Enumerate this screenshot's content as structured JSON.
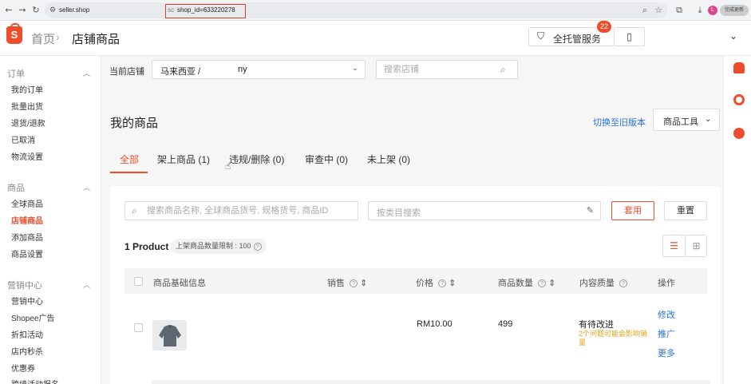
{
  "browser": {
    "url_host": "seller.shop",
    "url_mid": "sc",
    "url_query": "shop_id=633220278",
    "finish_label": "完成更新",
    "avatar_initial": "L",
    "icons": [
      "back-icon",
      "forward-icon",
      "reload-icon",
      "site-info-icon",
      "zoom-icon",
      "star-icon",
      "extensions-icon",
      "download-icon",
      "chrome-menu-icon"
    ]
  },
  "header": {
    "breadcrumb_home": "首页",
    "breadcrumb_current": "店铺商品",
    "service_label": "全托管服务",
    "service_badge": "22"
  },
  "sidebar": {
    "groups": [
      {
        "title": "订单",
        "items": [
          "我的订单",
          "批量出货",
          "退货/退款",
          "已取消",
          "物流设置"
        ]
      },
      {
        "title": "商品",
        "items": [
          "全球商品",
          "店铺商品",
          "添加商品",
          "商品设置"
        ]
      },
      {
        "title": "营销中心",
        "items": [
          "营销中心",
          "Shopee广告",
          "折扣活动",
          "店内秒杀",
          "优惠券",
          "跨境活动报名"
        ]
      }
    ],
    "active_item": "店铺商品"
  },
  "shop_selector": {
    "label": "当前店铺",
    "value_part1": "马来西亚 /",
    "value_part2": "ny",
    "search_placeholder": "搜索店铺"
  },
  "main": {
    "title": "我的商品",
    "switch_link": "切换至旧版本",
    "tools_label": "商品工具",
    "tabs": [
      {
        "label": "全部"
      },
      {
        "label": "架上商品 (1)"
      },
      {
        "label": "违规/删除 (0)"
      },
      {
        "label": "审查中 (0)"
      },
      {
        "label": "未上架 (0)"
      }
    ],
    "active_tab": "全部",
    "filters": {
      "keyword_placeholder": "搜索商品名称, 全球商品货号, 规格货号, 商品ID",
      "category_placeholder": "按类目搜索",
      "apply_label": "套用",
      "reset_label": "重置"
    },
    "product_count": "1 Product",
    "listing_limit": "上架商品数量限制 : 100"
  },
  "table": {
    "headers": {
      "info": "商品基础信息",
      "sales": "销售",
      "price": "价格",
      "stock": "商品数量",
      "quality": "内容质量",
      "actions": "操作"
    },
    "rows": [
      {
        "price": "RM10.00",
        "stock": "499",
        "quality_title": "有待改进",
        "quality_note": "2个问题可能会影响销量",
        "actions": [
          "修改",
          "推广",
          "更多"
        ]
      }
    ]
  },
  "colors": {
    "brand": "#ee4d2d",
    "link": "#2673dd",
    "warning": "#e3a21a"
  }
}
